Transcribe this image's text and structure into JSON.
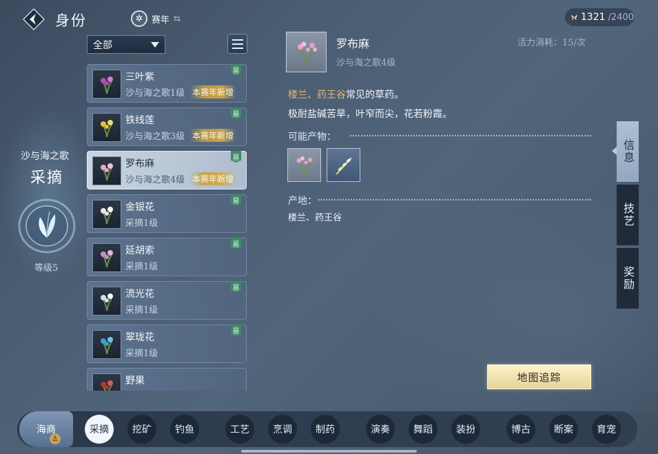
{
  "header": {
    "title": "身份",
    "season_label": "赛年",
    "energy_current": "1321",
    "energy_max": "/2400"
  },
  "identity": {
    "subtitle": "沙与海之歌",
    "name": "采摘",
    "level": "等级5"
  },
  "filter": {
    "selected": "全部"
  },
  "list": [
    {
      "name": "三叶紫",
      "sub": "沙与海之歌1级",
      "new": "本赛年新增",
      "badge": "易"
    },
    {
      "name": "铁线莲",
      "sub": "沙与海之歌3级",
      "new": "本赛年新增",
      "badge": "易"
    },
    {
      "name": "罗布麻",
      "sub": "沙与海之歌4级",
      "new": "本赛年新增",
      "badge": "易",
      "selected": true
    },
    {
      "name": "金银花",
      "sub": "采摘1级",
      "new": "",
      "badge": "易"
    },
    {
      "name": "延胡索",
      "sub": "采摘1级",
      "new": "",
      "badge": "易"
    },
    {
      "name": "流光花",
      "sub": "采摘1级",
      "new": "",
      "badge": "易"
    },
    {
      "name": "翠珑花",
      "sub": "采摘1级",
      "new": "",
      "badge": "易"
    },
    {
      "name": "野果",
      "sub": "",
      "new": "",
      "badge": ""
    }
  ],
  "detail": {
    "name": "罗布麻",
    "source": "沙与海之歌4级",
    "cost": "活力消耗：15/次",
    "desc_highlight": "楼兰、药王谷",
    "desc_rest": "常见的草药。",
    "desc_line2": "极耐盐碱苦旱，叶窄而尖，花若粉霞。",
    "products_label": "可能产物：",
    "origin_label": "产地：",
    "origin_value": "楼兰、药王谷"
  },
  "tabs": {
    "info": "信息",
    "skill": "技艺",
    "reward": "奖励"
  },
  "track_button": "地图追踪",
  "bottom": {
    "haishang": "海商",
    "haishang_badge": "♙",
    "items": [
      "采摘",
      "挖矿",
      "钓鱼",
      "工艺",
      "烹调",
      "制药",
      "演奏",
      "舞蹈",
      "装扮",
      "博古",
      "断案",
      "育宠"
    ]
  },
  "colors": {
    "accent_gold": "#e8b86b",
    "badge_green": "#3f8a66",
    "button_gold": "#fff2c8"
  }
}
